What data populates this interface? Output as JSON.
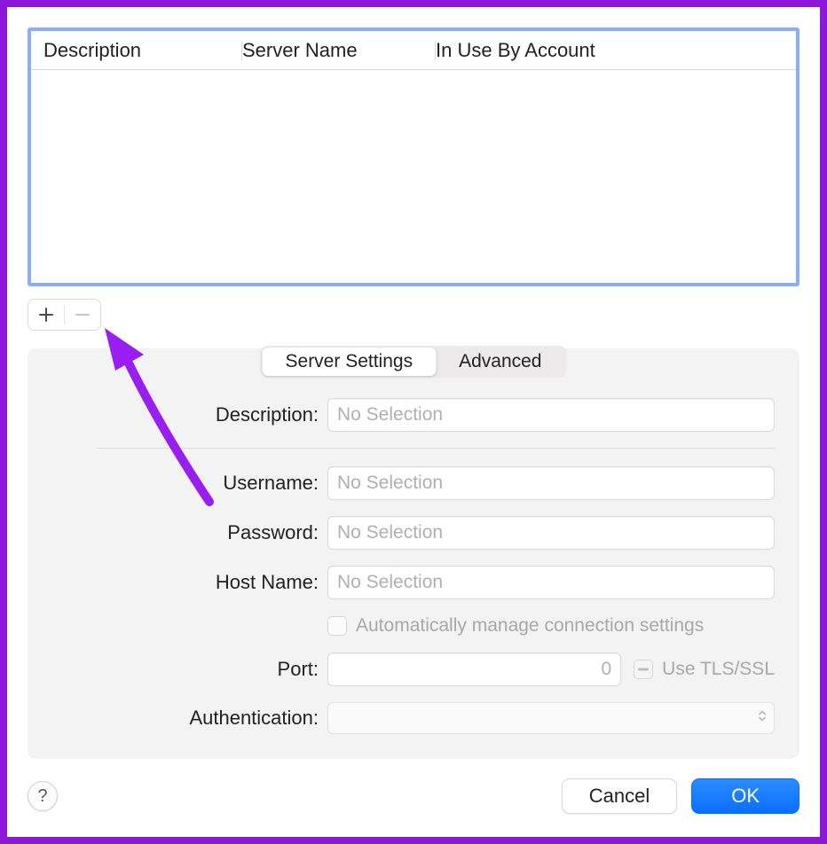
{
  "table": {
    "columns": [
      "Description",
      "Server Name",
      "In Use By Account"
    ]
  },
  "tabs": {
    "server_settings": "Server Settings",
    "advanced": "Advanced",
    "active": "server_settings"
  },
  "form": {
    "description": {
      "label": "Description:",
      "placeholder": "No Selection"
    },
    "username": {
      "label": "Username:",
      "placeholder": "No Selection"
    },
    "password": {
      "label": "Password:",
      "placeholder": "No Selection"
    },
    "host_name": {
      "label": "Host Name:",
      "placeholder": "No Selection"
    },
    "auto_manage": {
      "label": "Automatically manage connection settings",
      "checked": false
    },
    "port": {
      "label": "Port:",
      "value": "0"
    },
    "tls_ssl": {
      "label": "Use TLS/SSL",
      "checked": false
    },
    "authentication": {
      "label": "Authentication:",
      "value": ""
    }
  },
  "buttons": {
    "help": "?",
    "cancel": "Cancel",
    "ok": "OK"
  },
  "annotation": {
    "arrow_color": "#991ef1"
  }
}
